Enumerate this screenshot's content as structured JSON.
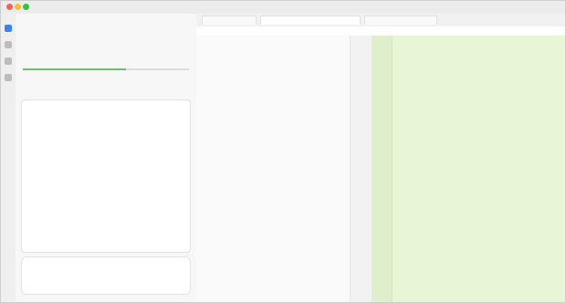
{
  "app": {
    "title": "",
    "status_text": ""
  },
  "left_panel": {
    "header": "",
    "message_1": "",
    "message_2": "",
    "progress": 0.62,
    "progress_label": "",
    "card": {
      "title": "",
      "body": "",
      "bullets": []
    },
    "composer_placeholder": ""
  },
  "editor": {
    "tabs": [
      {
        "label": ""
      },
      {
        "label": ""
      },
      {
        "label": ""
      }
    ],
    "breadcrumbs": "",
    "code_lines": []
  },
  "colors": {
    "accent_green": "#6bc26b",
    "diff_bg": "#e9f6d6",
    "line_num_bg": "#dfeecb",
    "red_tab": "#d44444"
  },
  "icons": {
    "sidebar_nav_1": "chat-icon",
    "sidebar_nav_2": "search-icon",
    "sidebar_nav_3": "settings-icon",
    "sidebar_nav_4": "folder-icon"
  }
}
